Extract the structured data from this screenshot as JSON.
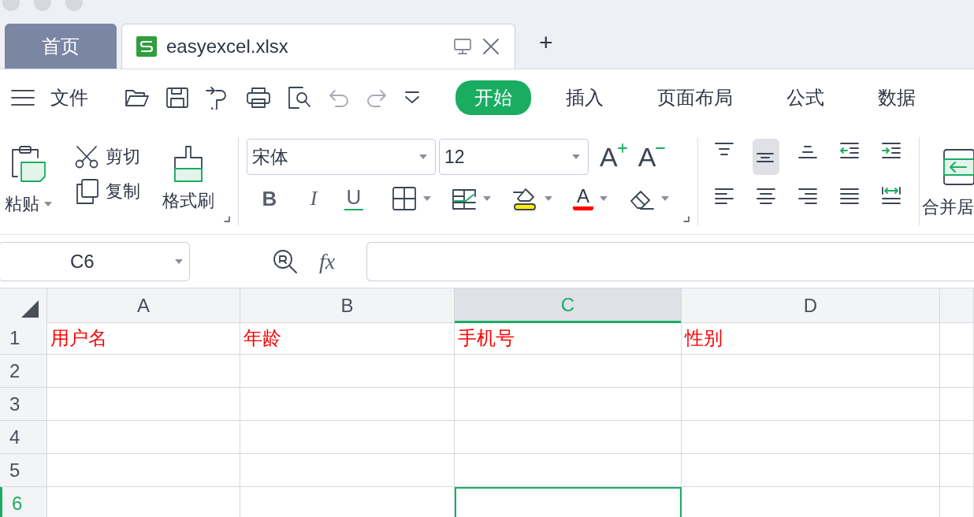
{
  "window_tabs": [
    {
      "label": "首页",
      "kind": "home",
      "selected": false
    },
    {
      "label": "easyexcel.xlsx",
      "kind": "file",
      "selected": true
    }
  ],
  "new_tab": "+",
  "menu": {
    "file": "文件",
    "tabs": [
      {
        "label": "开始",
        "selected": true
      },
      {
        "label": "插入",
        "selected": false
      },
      {
        "label": "页面布局",
        "selected": false
      },
      {
        "label": "公式",
        "selected": false
      },
      {
        "label": "数据",
        "selected": false
      }
    ]
  },
  "ribbon": {
    "paste": "粘贴",
    "cut": "剪切",
    "copy": "复制",
    "format_painter": "格式刷",
    "font": "宋体",
    "font_size": "12",
    "grow_font": "A",
    "shrink_font": "A",
    "bold": "B",
    "italic": "I",
    "underline": "U",
    "font_color": "A",
    "align_buttons": [
      {
        "kind": "top",
        "selected": false
      },
      {
        "kind": "middle",
        "selected": true
      },
      {
        "kind": "bottom",
        "selected": false
      },
      {
        "kind": "outdent",
        "selected": false
      },
      {
        "kind": "indent",
        "selected": false
      },
      {
        "kind": "left",
        "selected": false
      },
      {
        "kind": "center",
        "selected": false
      },
      {
        "kind": "right",
        "selected": false
      },
      {
        "kind": "justify",
        "selected": false
      },
      {
        "kind": "distributed",
        "selected": false
      }
    ],
    "merge": "合并居"
  },
  "formula_bar": {
    "name_box": "C6",
    "fx": "fx"
  },
  "sheet": {
    "columns": [
      {
        "label": "A",
        "selected": false
      },
      {
        "label": "B",
        "selected": false
      },
      {
        "label": "C",
        "selected": true
      },
      {
        "label": "D",
        "selected": false
      }
    ],
    "rows": [
      {
        "label": "1",
        "selected": false,
        "cells": [
          {
            "text": "用户名",
            "selected": false
          },
          {
            "text": "年龄",
            "selected": false
          },
          {
            "text": "手机号",
            "selected": false
          },
          {
            "text": "性别",
            "selected": false
          }
        ]
      },
      {
        "label": "2",
        "selected": false,
        "cells": [
          {
            "selected": false
          },
          {
            "selected": false
          },
          {
            "selected": false
          },
          {
            "selected": false
          }
        ]
      },
      {
        "label": "3",
        "selected": false,
        "cells": [
          {
            "selected": false
          },
          {
            "selected": false
          },
          {
            "selected": false
          },
          {
            "selected": false
          }
        ]
      },
      {
        "label": "4",
        "selected": false,
        "cells": [
          {
            "selected": false
          },
          {
            "selected": false
          },
          {
            "selected": false
          },
          {
            "selected": false
          }
        ]
      },
      {
        "label": "5",
        "selected": false,
        "cells": [
          {
            "selected": false
          },
          {
            "selected": false
          },
          {
            "selected": false
          },
          {
            "selected": false
          }
        ]
      },
      {
        "label": "6",
        "selected": true,
        "cells": [
          {
            "selected": false
          },
          {
            "selected": false
          },
          {
            "selected": true
          },
          {
            "selected": false
          }
        ]
      }
    ]
  }
}
